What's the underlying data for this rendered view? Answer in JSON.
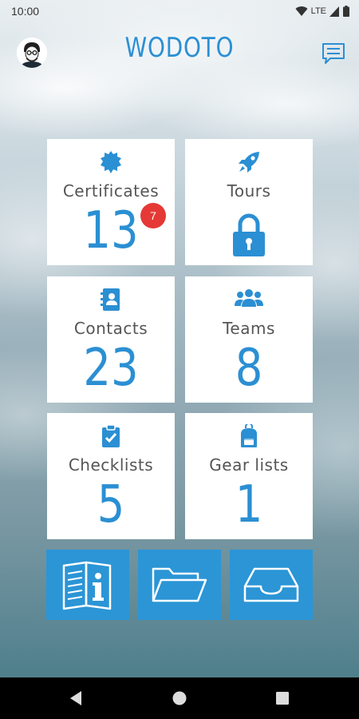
{
  "status_bar": {
    "time": "10:00",
    "network": "LTE",
    "icons": [
      "wifi-icon",
      "signal-icon",
      "battery-icon"
    ]
  },
  "header": {
    "title": "WODOTO",
    "avatar": "user-avatar",
    "message_icon": "chat-icon"
  },
  "tiles": [
    {
      "id": "certificates",
      "label": "Certificates",
      "count": "13",
      "icon": "badge-icon",
      "badge": "7"
    },
    {
      "id": "tours",
      "label": "Tours",
      "icon": "rocket-icon",
      "locked": true,
      "lock_icon": "lock-icon"
    },
    {
      "id": "contacts",
      "label": "Contacts",
      "count": "23",
      "icon": "address-book-icon"
    },
    {
      "id": "teams",
      "label": "Teams",
      "count": "8",
      "icon": "users-icon"
    },
    {
      "id": "checklists",
      "label": "Checklists",
      "count": "5",
      "icon": "clipboard-check-icon"
    },
    {
      "id": "gear_lists",
      "label": "Gear lists",
      "count": "1",
      "icon": "backpack-icon"
    }
  ],
  "actions": [
    {
      "id": "manual",
      "icon": "manual-info-icon"
    },
    {
      "id": "folder",
      "icon": "folder-open-icon"
    },
    {
      "id": "inbox",
      "icon": "inbox-tray-icon"
    }
  ],
  "nav_bar": {
    "icons": [
      "back-icon",
      "home-icon",
      "recents-icon"
    ]
  },
  "colors": {
    "accent": "#2b8fd3",
    "action_bg": "#2b95d6",
    "badge": "#e53935",
    "tile_bg": "#ffffff",
    "label": "#555555"
  }
}
